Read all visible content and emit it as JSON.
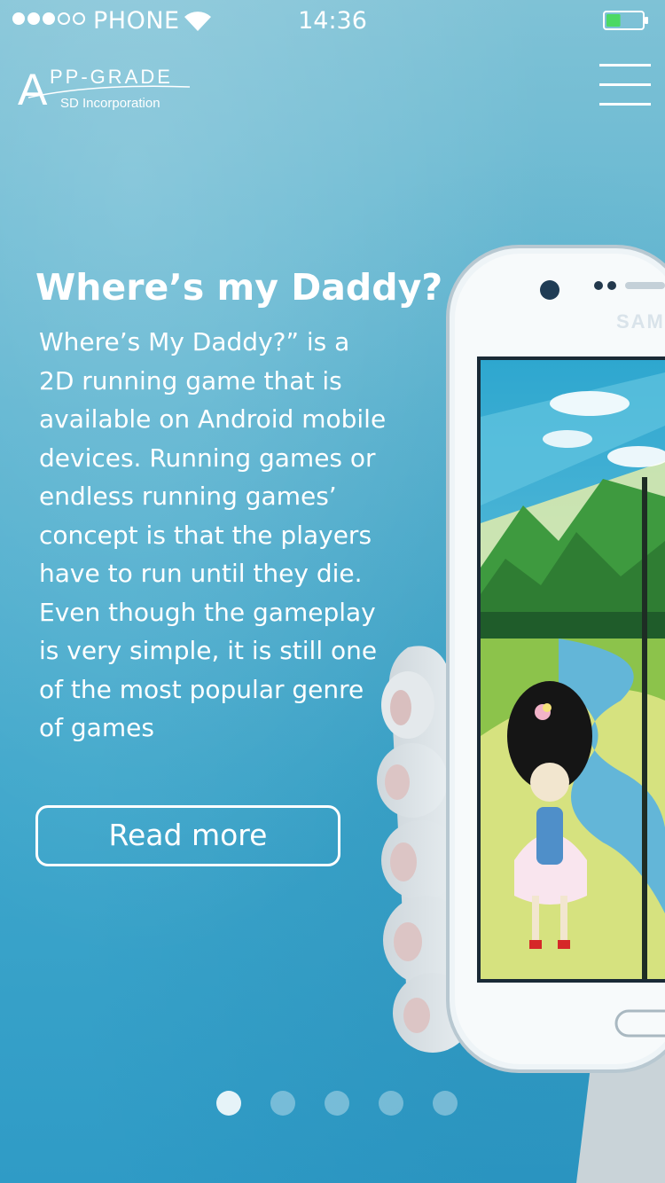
{
  "status_bar": {
    "signal": {
      "filled": 3,
      "total": 5
    },
    "carrier": "PHONE",
    "time": "14:36",
    "battery": {
      "level": 0.4,
      "color": "#4cd964"
    }
  },
  "header": {
    "logo": {
      "mark": "A",
      "name": "PP-GRADE",
      "sub": "SD Incorporation"
    },
    "menu_icon": "hamburger-menu-icon"
  },
  "slide": {
    "title": "Where’s my Daddy?",
    "description": "Where’s My Daddy?” is a 2D running game that is available on Android mobile devices. Running games or endless running games’ concept is that the players have to run until they die. Even though the gameplay is very simple, it is still one of the most popular genre of games",
    "read_more_label": "Read more",
    "phone_brand": "SAMSUNG"
  },
  "pagination": {
    "pages": 5,
    "active": 1
  },
  "colors": {
    "background_top": "#7fc2d6",
    "background_bottom": "#2f9bc6",
    "text": "#ffffff",
    "battery_fill": "#4cd964"
  }
}
